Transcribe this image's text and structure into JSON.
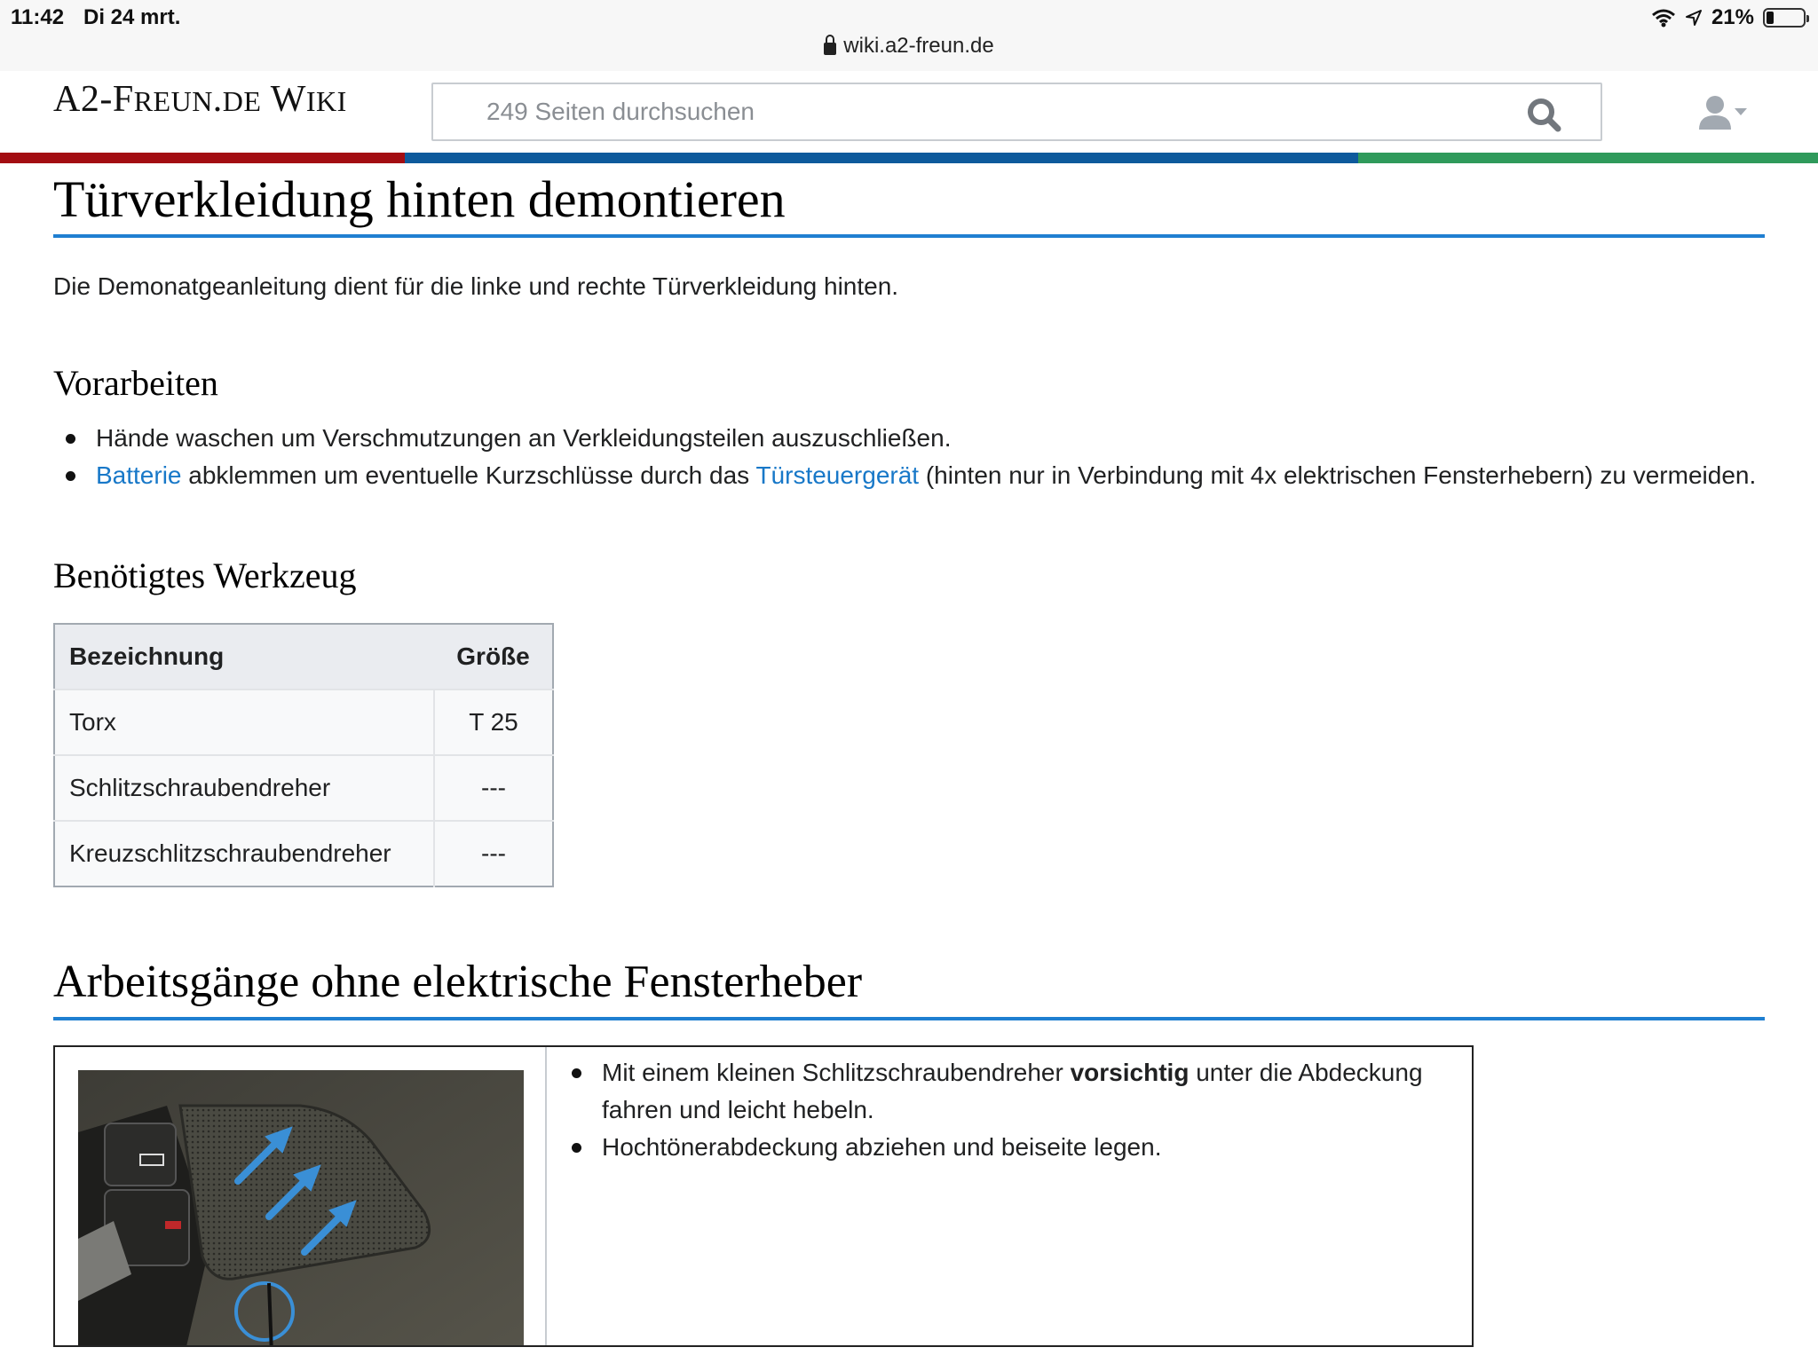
{
  "status_bar": {
    "time": "11:42",
    "date": "Di 24 mrt.",
    "battery": "21%",
    "battery_level": 0.21,
    "url": "wiki.a2-freun.de"
  },
  "header": {
    "logo": {
      "part1": "A2-F",
      "part2": "REUN",
      "part3": ".",
      "part4": "DE",
      "part5": " W",
      "part6": "IKI"
    },
    "search_placeholder": "249 Seiten durchsuchen",
    "icons": {
      "search": "search-icon",
      "user": "user-icon"
    }
  },
  "colors": {
    "red": "#a30d12",
    "blue": "#0e5a9c",
    "green": "#2f9a5b",
    "link": "#1878c8",
    "rule": "#1f7fd1"
  },
  "page": {
    "title": "Türverkleidung hinten demontieren",
    "intro": "Die Demonatgeanleitung dient für die linke und rechte Türverkleidung hinten.",
    "vorarbeiten": {
      "heading": "Vorarbeiten",
      "item1": "Hände waschen um Verschmutzungen an Verkleidungsteilen auszuschließen.",
      "item2_link1": "Batterie",
      "item2_text1": " abklemmen um eventuelle Kurzschlüsse durch das ",
      "item2_link2": "Türsteuergerät",
      "item2_text2": " (hinten nur in Verbindung mit 4x elektrischen Fensterhebern) zu vermeiden."
    },
    "werkzeug": {
      "heading": "Benötigtes Werkzeug",
      "col_name": "Bezeichnung",
      "col_size": "Größe",
      "rows": [
        {
          "name": "Torx",
          "size": "T 25"
        },
        {
          "name": "Schlitzschraubendreher",
          "size": "---"
        },
        {
          "name": "Kreuzschlitzschraubendreher",
          "size": "---"
        }
      ]
    },
    "section2": {
      "heading": "Arbeitsgänge ohne elektrische Fensterheber",
      "step1_a": "Mit einem kleinen Schlitzschraubendreher ",
      "step1_bold": "vorsichtig",
      "step1_b": " unter die Abdeckung fahren und leicht hebeln.",
      "step2": "Hochtönerabdeckung abziehen und beiseite legen."
    }
  }
}
